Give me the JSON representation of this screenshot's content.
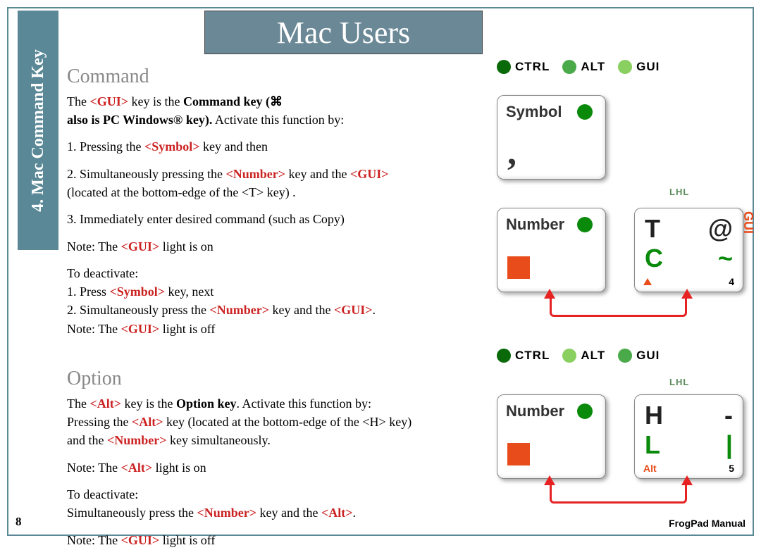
{
  "sidebar": {
    "label": "4. Mac Command Key"
  },
  "title": "Mac Users",
  "command": {
    "heading": "Command",
    "line1a": "The ",
    "line1b": "<GUI>",
    "line1c": " key is the ",
    "line1d": "Command key (⌘",
    "line1e": "",
    "line2a": "also is PC Windows® key).",
    "line2b": " Activate this function by:",
    "step1a": "1. Pressing the ",
    "step1b": "<Symbol>",
    "step1c": " key and then",
    "step2a": "2. Simultaneously pressing the ",
    "step2b": "<Number>",
    "step2c": " key and the ",
    "step2d": "<GUI>",
    "step2e": "(located at the bottom-edge of the <T> key) .",
    "step3": "3. Immediately enter desired command (such as Copy)",
    "note1a": "Note: The ",
    "note1b": "<GUI>",
    "note1c": " light is on",
    "deact": "To deactivate:",
    "d1a": "1. Press ",
    "d1b": "<Symbol>",
    "d1c": " key, next",
    "d2a": "2. Simultaneously press the ",
    "d2b": "<Number>",
    "d2c": " key and the ",
    "d2d": "<GUI>",
    "d2e": ".",
    "note2a": "Note: The ",
    "note2b": "<GUI>",
    "note2c": " light is off"
  },
  "option": {
    "heading": "Option",
    "line1a": "The ",
    "line1b": "<Alt>",
    "line1c": " key is the ",
    "line1d": "Option key",
    "line1e": ".  Activate this function by:",
    "line2a": "Pressing the ",
    "line2b": "<Alt>",
    "line2c": " key (located at the bottom-edge of the <H> key)",
    "line3a": "and the ",
    "line3b": "<Number>",
    "line3c": " key simultaneously.",
    "note1a": "Note: The ",
    "note1b": "<Alt>",
    "note1c": " light is on",
    "deact": "To deactivate:",
    "d1a": "Simultaneously press the ",
    "d1b": "<Number>",
    "d1c": " key and the ",
    "d1d": "<Alt>",
    "d1e": ".",
    "note2a": "Note: The ",
    "note2b": "<GUI>",
    "note2c": " light is off"
  },
  "leds": {
    "ctrl": "CTRL",
    "alt": "ALT",
    "gui": "GUI"
  },
  "keys": {
    "symbol": {
      "label": "Symbol",
      "glyph": ","
    },
    "number": {
      "label": "Number"
    },
    "t_key": {
      "top_left": "T",
      "top_right": "@",
      "mid_left": "C",
      "mid_right": "~",
      "bottom_right": "4",
      "side": "GUI"
    },
    "h_key": {
      "top_left": "H",
      "top_right": "-",
      "mid_left": "L",
      "mid_right": "|",
      "bottom_left": "Alt",
      "bottom_right": "5"
    },
    "lhl": "LHL"
  },
  "page_number": "8",
  "footer": "FrogPad Manual"
}
